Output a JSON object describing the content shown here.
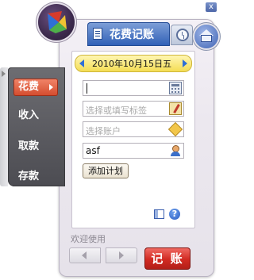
{
  "window": {
    "title": "花费记账",
    "close_glyph": "x"
  },
  "sidebar": {
    "items": [
      {
        "label": "花费",
        "active": true
      },
      {
        "label": "收入",
        "active": false
      },
      {
        "label": "取款",
        "active": false
      },
      {
        "label": "存款",
        "active": false
      }
    ]
  },
  "date_bar": {
    "date_text": "2010年10月15日五"
  },
  "form": {
    "amount": {
      "value": ""
    },
    "tag": {
      "placeholder": "选择或填写标签"
    },
    "account": {
      "placeholder": "选择账户"
    },
    "person": {
      "value": "asf"
    },
    "add_plan_label": "添加计划"
  },
  "footer": {
    "welcome_text": "欢迎使用",
    "record_label": "记 账"
  },
  "help_glyph": "?",
  "icons": [
    "logo-icon",
    "book-icon",
    "clock-icon",
    "home-icon",
    "calculator-icon",
    "tag-icon",
    "box-icon",
    "user-icon",
    "layout-icon",
    "help-icon"
  ],
  "colors": {
    "accent_blue": "#2f5fb6",
    "active_nav": "#d24a2c",
    "record_button": "#d12a22",
    "date_bar": "#f4dd54"
  }
}
